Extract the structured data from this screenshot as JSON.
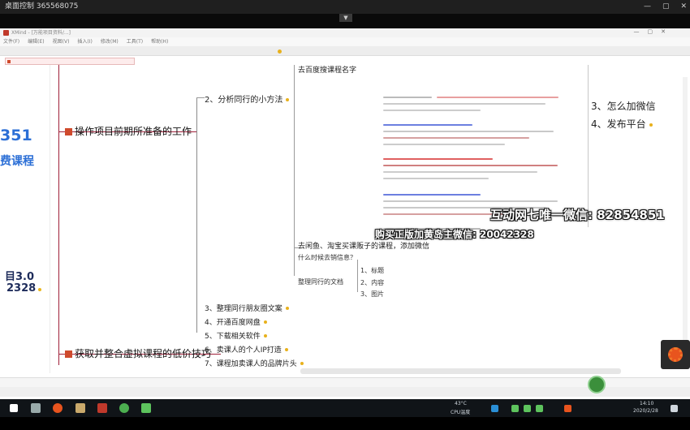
{
  "remote_window": {
    "title": "桌面控制 365568075",
    "controls": [
      "—",
      "▢",
      "✕"
    ]
  },
  "app": {
    "title": "XMind - [万能项目资料/...]",
    "menu": [
      "文件(F)",
      "编辑(E)",
      "视图(V)",
      "插入(I)",
      "修改(M)",
      "工具(T)",
      "帮助(H)"
    ],
    "left_panel": {
      "number": "351",
      "course": "费课程",
      "version": "目3.0",
      "code": "2328"
    },
    "mindmap": {
      "main_node_1": "操作项目前期所准备的工作",
      "main_node_2": "获取并整合虚拟课程的低价技巧",
      "sub_analyze": "2、分析同行的小方法",
      "top_label": "去百度搜课程名字",
      "xianyu_note": "去闲鱼、淘宝买课贩子的课程，添加微信",
      "when_info": "什么时候去销信息？",
      "org_docs": "整理同行的文档",
      "doc_items": [
        "1、标题",
        "2、内容",
        "3、图片"
      ],
      "steps": [
        "3、整理同行朋友圈文案",
        "4、开通百度网盘",
        "5、下载相关软件",
        "6、卖课人的个人IP打造",
        "7、课程加卖课人的品牌片头"
      ],
      "right_list": [
        "3、怎么加微信",
        "4、发布平台"
      ]
    },
    "watermarks": [
      "互动网七唯一微信: 82854851",
      "购买正版加黄岛主微信: 20042328"
    ]
  },
  "taskbar": {
    "temperature": "43°C",
    "cpu_label": "CPU温度",
    "time": "14:10",
    "date": "2020/2/28"
  }
}
